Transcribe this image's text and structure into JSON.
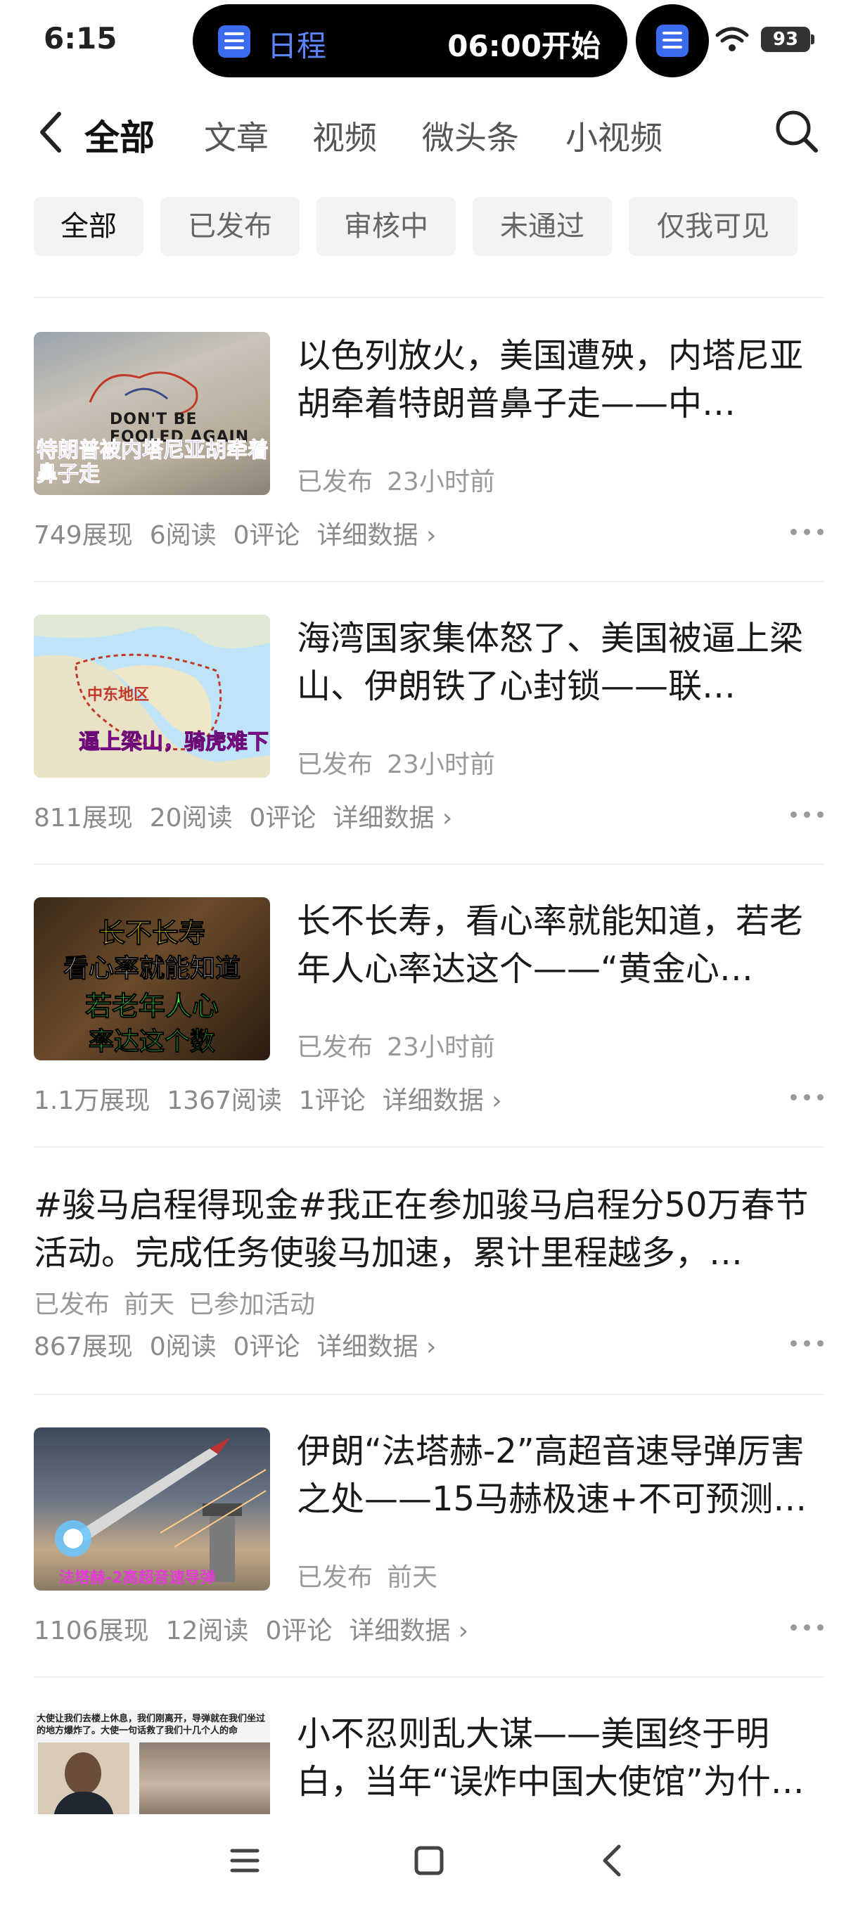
{
  "status_bar": {
    "time": "6:15",
    "island_title": "日程",
    "island_time": "06:00开始",
    "battery": "93"
  },
  "nav": {
    "tabs": [
      "全部",
      "文章",
      "视频",
      "微头条",
      "小视频"
    ]
  },
  "filters": [
    "全部",
    "已发布",
    "审核中",
    "未通过",
    "仅我可见"
  ],
  "items": [
    {
      "title": "以色列放火，美国遭殃，内塔尼亚胡牵着特朗普鼻子走——中…",
      "thumb_caption": "特朗普被内塔尼亚胡牵着鼻子走",
      "thumb_overlay": "DON'T BE FOOLED AGAIN",
      "status": "已发布",
      "time": "23小时前",
      "impressions": "749展现",
      "reads": "6阅读",
      "comments": "0评论",
      "details": "详细数据"
    },
    {
      "title": "海湾国家集体怒了、美国被逼上梁山、伊朗铁了心封锁——联…",
      "thumb_caption": "逼上梁山，骑虎难下",
      "thumb_overlay": "中东地区",
      "status": "已发布",
      "time": "23小时前",
      "impressions": "811展现",
      "reads": "20阅读",
      "comments": "0评论",
      "details": "详细数据"
    },
    {
      "title": "长不长寿，看心率就能知道，若老年人心率达这个——“黄金心…",
      "thumb_lines": [
        "长不长寿",
        "看心率就能知道",
        "若老年人心",
        "率达这个数"
      ],
      "status": "已发布",
      "time": "23小时前",
      "impressions": "1.1万展现",
      "reads": "1367阅读",
      "comments": "1评论",
      "details": "详细数据"
    },
    {
      "title": "#骏马启程得现金#我正在参加骏马启程分50万春节活动。完成任务使骏马加速，累计里程越多，…",
      "status": "已发布",
      "time": "前天",
      "extra": "已参加活动",
      "impressions": "867展现",
      "reads": "0阅读",
      "comments": "0评论",
      "details": "详细数据"
    },
    {
      "title": "伊朗“法塔赫-2”高超音速导弹厉害之处——15马赫极速+不可预测…",
      "thumb_caption": "法塔赫-2高超音速导弹",
      "status": "已发布",
      "time": "前天",
      "impressions": "1106展现",
      "reads": "12阅读",
      "comments": "0评论",
      "details": "详细数据"
    },
    {
      "title": "小不忍则乱大谋——美国终于明白，当年“误炸中国大使馆”为什…",
      "thumb_caption": "大使让我们去楼上休息，我们刚离开，导弹就在我们坐过的地方爆炸了。大使一句话救了我们十几个人的命"
    }
  ]
}
